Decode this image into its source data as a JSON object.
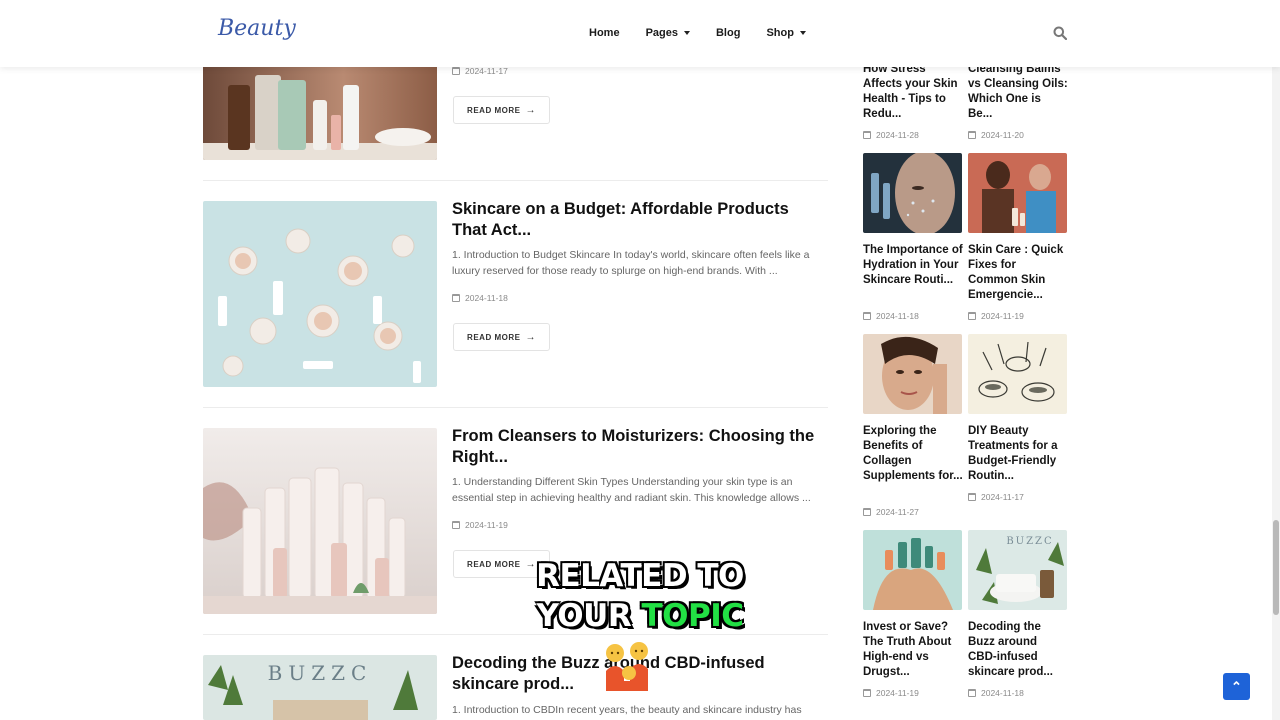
{
  "header": {
    "logo_text": "Beauty",
    "nav": [
      {
        "label": "Home",
        "has_dropdown": false
      },
      {
        "label": "Pages",
        "has_dropdown": true
      },
      {
        "label": "Blog",
        "has_dropdown": false
      },
      {
        "label": "Shop",
        "has_dropdown": true
      }
    ],
    "search_icon": "search-icon"
  },
  "posts": [
    {
      "title": "",
      "excerpt": "",
      "date": "2024-11-17",
      "read_more": "READ MORE"
    },
    {
      "title": "Skincare on a Budget: Affordable Products That Act...",
      "excerpt": "1. Introduction to Budget Skincare In today's world, skincare often feels like a luxury reserved for those ready to splurge on high-end brands. With ...",
      "date": "2024-11-18",
      "read_more": "READ MORE"
    },
    {
      "title": "From Cleansers to Moisturizers: Choosing the Right...",
      "excerpt": "1. Understanding Different Skin Types Understanding your skin type is an essential step in achieving healthy and radiant skin. This knowledge allows ...",
      "date": "2024-11-19",
      "read_more": "READ MORE"
    },
    {
      "title": "Decoding the Buzz around CBD-infused skincare prod...",
      "excerpt": "1. Introduction to CBDIn recent years, the beauty and skincare industry has",
      "date": "",
      "read_more": "",
      "image_text": "BUZZC"
    }
  ],
  "sidebar": [
    {
      "title": "How Stress Affects your Skin Health - Tips to Redu...",
      "date": "2024-11-28"
    },
    {
      "title": "Cleansing Balms vs Cleansing Oils: Which One is Be...",
      "date": "2024-11-20"
    },
    {
      "title": "The Importance of Hydration in Your Skincare Routi...",
      "date": "2024-11-18"
    },
    {
      "title": "Skin Care : Quick Fixes for Common Skin Emergencie...",
      "date": "2024-11-19"
    },
    {
      "title": "Exploring the Benefits of Collagen Supplements for...",
      "date": "2024-11-27"
    },
    {
      "title": "DIY Beauty Treatments for a Budget-Friendly Routin...",
      "date": "2024-11-17"
    },
    {
      "title": "Invest or Save? The Truth About High-end vs Drugst...",
      "date": "2024-11-19"
    },
    {
      "title": "Decoding the Buzz around CBD-infused skincare prod...",
      "date": "2024-11-18",
      "image_text": "BUZZC"
    }
  ],
  "caption": {
    "line1": "RELATED TO",
    "line2a": "YOUR",
    "line2b": "TOPIC"
  },
  "colors": {
    "accent_blue": "#1e63d8",
    "caption_green": "#22e044"
  }
}
